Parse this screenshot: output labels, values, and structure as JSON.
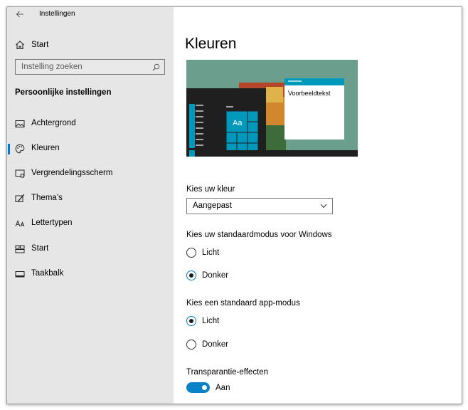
{
  "app": {
    "title": "Instellingen"
  },
  "sidebar": {
    "home_label": "Start",
    "search_placeholder": "Instelling zoeken",
    "section_heading": "Persoonlijke instellingen",
    "items": [
      {
        "label": "Achtergrond",
        "icon": "picture-icon"
      },
      {
        "label": "Kleuren",
        "icon": "palette-icon",
        "selected": true
      },
      {
        "label": "Vergrendelingsscherm",
        "icon": "lock-screen-icon"
      },
      {
        "label": "Thema’s",
        "icon": "theme-brush-icon"
      },
      {
        "label": "Lettertypen",
        "icon": "font-icon"
      },
      {
        "label": "Start",
        "icon": "start-menu-icon"
      },
      {
        "label": "Taakbalk",
        "icon": "taskbar-icon"
      }
    ]
  },
  "main": {
    "title": "Kleuren",
    "preview": {
      "sample_text": "Voorbeeldtekst",
      "tile_label": "Aa",
      "background_color": "#6b9e8d",
      "accent_color": "#0099bc"
    },
    "color_choice": {
      "label": "Kies uw kleur",
      "value": "Aangepast"
    },
    "windows_mode": {
      "label": "Kies uw standaardmodus voor Windows",
      "options": [
        "Licht",
        "Donker"
      ],
      "selected": "Donker"
    },
    "app_mode": {
      "label": "Kies een standaard app-modus",
      "options": [
        "Licht",
        "Donker"
      ],
      "selected": "Licht"
    },
    "transparency": {
      "label": "Transparantie-effecten",
      "state_label": "Aan",
      "on": true
    },
    "accent_color": "#0078d7"
  }
}
